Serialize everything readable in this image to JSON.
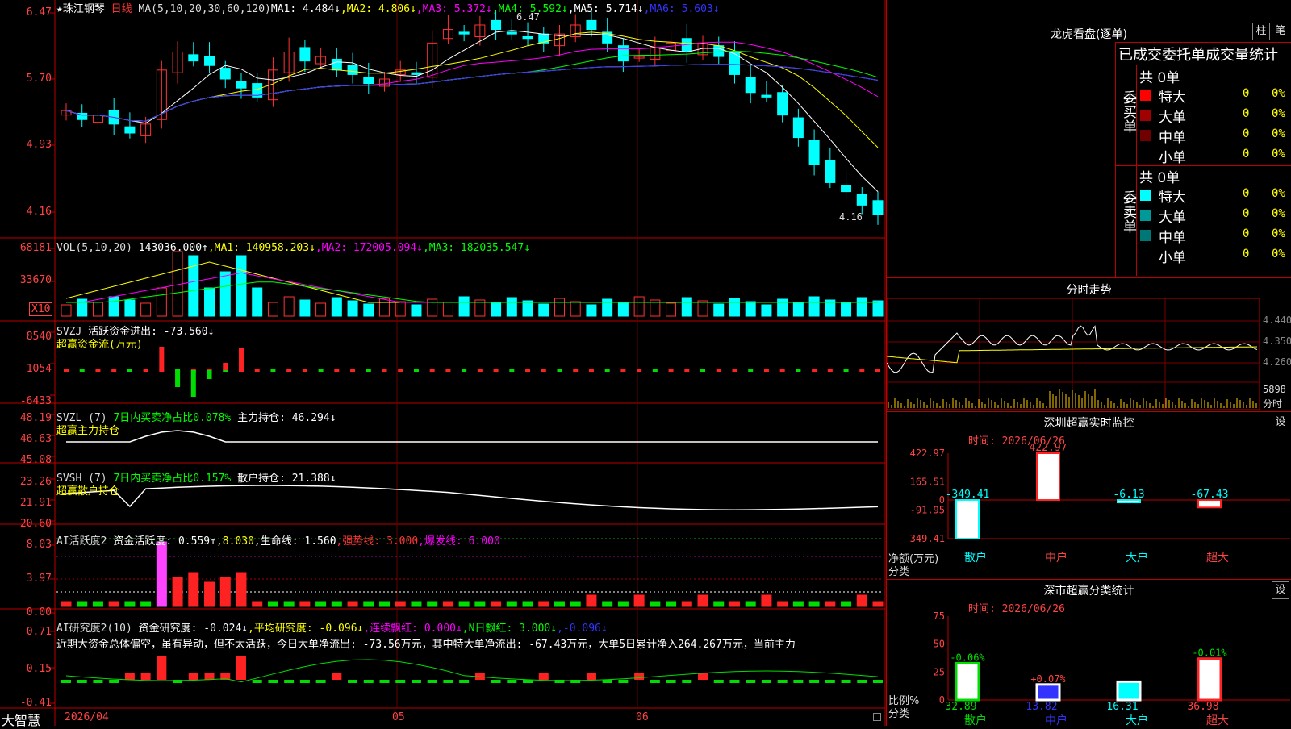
{
  "header": {
    "star": "★",
    "stock_name": "珠江钢琴",
    "period": "日线",
    "ma_label": "MA(5,10,20,30,60,120)",
    "ma_values": [
      {
        "text": "MA1: 4.484↓",
        "color": "#ffffff"
      },
      {
        "text": ",MA2: 4.806↓",
        "color": "#ffff00"
      },
      {
        "text": ",MA3: 5.372↓",
        "color": "#ff00ff"
      },
      {
        "text": ",MA4: 5.592↓",
        "color": "#00ff00"
      },
      {
        "text": ",MA5: 5.714↓",
        "color": "#ffffff"
      },
      {
        "text": ",MA6: 5.603↓",
        "color": "#3333ff"
      }
    ],
    "high_label": "6.47",
    "low_label": "4.16"
  },
  "price_axis": [
    "6.47",
    "5.70",
    "4.93",
    "4.16"
  ],
  "vol_panel": {
    "title": "VOL(5,10,20)",
    "value": "143036.000↑",
    "ma1": ",MA1: 140958.203↓",
    "ma2": ",MA2: 172005.094↓",
    "ma3": ",MA3: 182035.547↓",
    "axis": [
      "68181",
      "33670"
    ],
    "unit": "X10"
  },
  "svzj_panel": {
    "title": "SVZJ",
    "label": "活跃资金进出: -73.560↓",
    "subtitle": "超赢资金流(万元)",
    "axis": [
      "8540",
      "1054",
      "-6433"
    ]
  },
  "svzl_panel": {
    "title": "SVZL (7)",
    "label1": "7日内买卖净占比0.078%",
    "label2": "主力持仓: 46.294↓",
    "subtitle": "超赢主力持仓",
    "axis": [
      "48.19",
      "46.63",
      "45.08"
    ]
  },
  "svsh_panel": {
    "title": "SVSH (7)",
    "label1": "7日内买卖净占比0.157%",
    "label2": "散户持仓: 21.388↓",
    "subtitle": "超赢散户持仓",
    "axis": [
      "23.26",
      "21.91",
      "20.60"
    ]
  },
  "ai_active_panel": {
    "title": "AI活跃度2",
    "label1": "资金活跃度: 0.559↑",
    "label2": ",8.030",
    "label3": ",生命线: 1.560",
    "label4": ",强势线: 3.000",
    "label5": ",爆发线: 6.000",
    "axis": [
      "8.03",
      "3.97",
      "0.00"
    ]
  },
  "ai_research_panel": {
    "title": "AI研究度2(10)",
    "label1": "资金研究度: -0.024↓",
    "label2": ",平均研究度: -0.096↓",
    "label3": ",连续飘红: 0.000↓",
    "label4": ",N日飘红: 3.000↓",
    "label5": ",-0.096↓",
    "text": "近期大资金总体偏空，虽有异动，但不太活跃，今日大单净流出: -73.56万元，其中特大单净流出: -67.43万元，大单5日累计净入264.267万元，当前主力",
    "axis": [
      "0.71",
      "0.15",
      "-0.41"
    ]
  },
  "x_axis": {
    "brand": "大智慧",
    "dates": [
      "2026/04",
      "05",
      "06"
    ]
  },
  "dragon_panel": {
    "title": "龙虎看盘(逐单)",
    "btn_bar": "柱",
    "btn_pen": "笔",
    "subtitle": "已成交委托单成交量统计",
    "buy_label": "委买单",
    "sell_label": "委卖单",
    "buy_total": "共 0单",
    "sell_total": "共 0单",
    "buy_rows": [
      {
        "label": "特大",
        "count": "0",
        "pct": "0%",
        "color": "#ff0000"
      },
      {
        "label": "大单",
        "count": "0",
        "pct": "0%",
        "color": "#a00000"
      },
      {
        "label": "中单",
        "count": "0",
        "pct": "0%",
        "color": "#700000"
      },
      {
        "label": "小单",
        "count": "0",
        "pct": "0%",
        "color": ""
      }
    ],
    "sell_rows": [
      {
        "label": "特大",
        "count": "0",
        "pct": "0%",
        "color": "#00ffff"
      },
      {
        "label": "大单",
        "count": "0",
        "pct": "0%",
        "color": "#009999"
      },
      {
        "label": "中单",
        "count": "0",
        "pct": "0%",
        "color": "#007777"
      },
      {
        "label": "小单",
        "count": "0",
        "pct": "0%",
        "color": ""
      }
    ]
  },
  "intraday_panel": {
    "title": "分时走势",
    "axis": [
      "4.440",
      "4.350",
      "4.260",
      "5898",
      "分时"
    ]
  },
  "sz_monitor": {
    "title": "深圳超赢实时监控",
    "btn": "设",
    "time": "时间: 2026/06/26",
    "axis": [
      "422.97",
      "165.51",
      "0",
      "-91.95",
      "-349.41"
    ],
    "bar_values": [
      "-349.41",
      "422.97",
      "-6.13",
      "-67.43"
    ],
    "categories": [
      "散户",
      "中户",
      "大户",
      "超大"
    ],
    "axis_label1": "净额(万元)",
    "axis_label2": "分类"
  },
  "sz_classify": {
    "title": "深市超赢分类统计",
    "btn": "设",
    "time": "时间: 2026/06/26",
    "axis": [
      "75",
      "50",
      "25",
      "0"
    ],
    "change_labels": [
      "-0.06%",
      "+0.07%",
      "",
      "-0.01%"
    ],
    "bar_values": [
      "32.89",
      "13.82",
      "16.31",
      "36.98"
    ],
    "categories": [
      "散户",
      "中户",
      "大户",
      "超大"
    ],
    "axis_label1": "比例%",
    "axis_label2": "分类"
  },
  "chart_data": [
    {
      "type": "bar",
      "title": "深圳超赢实时监控",
      "categories": [
        "散户",
        "中户",
        "大户",
        "超大"
      ],
      "values": [
        -349.41,
        422.97,
        -6.13,
        -67.43
      ],
      "ylabel": "净额(万元)",
      "xlabel": "分类",
      "ylim": [
        -349.41,
        422.97
      ]
    },
    {
      "type": "bar",
      "title": "深市超赢分类统计",
      "categories": [
        "散户",
        "中户",
        "大户",
        "超大"
      ],
      "values": [
        32.89,
        13.82,
        16.31,
        36.98
      ],
      "ylabel": "比例%",
      "xlabel": "分类",
      "ylim": [
        0,
        75
      ]
    },
    {
      "type": "line",
      "title": "",
      "series": [
        {
          "name": "K线",
          "values": [
            5.35,
            5.25,
            5.3,
            5.2,
            5.1,
            5.2,
            5.8,
            6.0,
            5.9,
            5.85,
            5.7,
            5.6,
            5.5,
            5.8,
            6.0,
            5.9,
            5.95,
            5.8,
            5.75,
            5.65,
            5.7,
            5.8,
            5.75,
            6.1,
            6.25,
            6.2,
            6.3,
            6.25,
            6.2,
            6.15,
            6.1,
            6.2,
            6.3,
            6.25,
            6.1,
            5.9,
            5.95,
            6.05,
            6.1,
            6.0,
            6.1,
            5.95,
            5.75,
            5.55,
            5.5,
            5.3,
            5.05,
            4.75,
            4.55,
            4.45,
            4.3,
            4.2
          ]
        }
      ],
      "ylim": [
        4.16,
        6.47
      ]
    }
  ]
}
